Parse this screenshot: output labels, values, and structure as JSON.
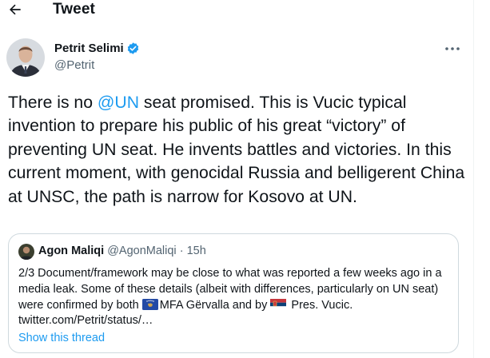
{
  "header": {
    "title": "Tweet",
    "back_icon": "arrow-left-icon"
  },
  "author": {
    "display_name": "Petrit Selimi",
    "handle": "@Petrit",
    "verified": true,
    "verified_color": "#1d9bf0"
  },
  "tweet": {
    "pre_mention": "There is no ",
    "mention": "@UN",
    "post_mention": " seat promised. This is Vucic typical invention to prepare his public of his great “victory” of preventing UN seat. He invents battles and victories. In this current moment, with genocidal Russia and belligerent China at UNSC, the path is narrow for Kosovo at UN."
  },
  "quote": {
    "name": "Agon Maliqi",
    "handle": "@AgonMaliqi",
    "separator": " · ",
    "time": "15h",
    "text_part1": "2/3 Document/framework may be close to what was reported a few weeks ago in a media leak. Some of these details (albeit with differences, particularly on UN seat) were confirmed by both ",
    "flag1": "kosovo-flag-icon",
    "text_part2": "MFA Gërvalla and by ",
    "flag2": "serbia-flag-icon",
    "text_part3": " Pres. Vucic.",
    "link_text": "twitter.com/Petrit/status/…",
    "show_thread": "Show this thread"
  },
  "colors": {
    "accent": "#1d9bf0",
    "secondary_text": "#536471",
    "border": "#cfd9de"
  }
}
